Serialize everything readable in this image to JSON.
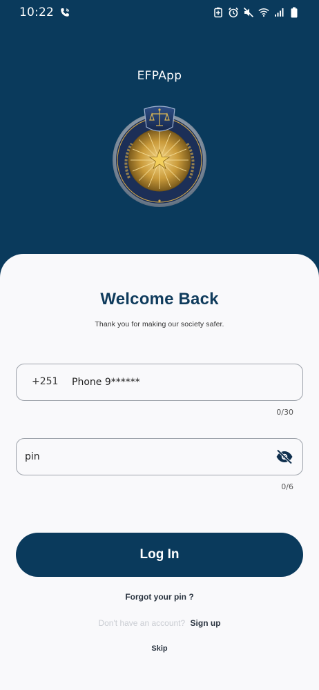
{
  "status_bar": {
    "time": "10:22",
    "icons": [
      "wifi-call-icon",
      "battery-saver-icon",
      "alarm-icon",
      "mute-icon",
      "wifi-icon",
      "signal-icon",
      "battery-icon"
    ]
  },
  "header": {
    "app_title": "EFPApp",
    "logo": "ethiopian-federal-police-emblem"
  },
  "login": {
    "title": "Welcome Back",
    "subtitle": "Thank you for making our society safer.",
    "phone": {
      "prefix": "+251",
      "placeholder": "Phone 9******",
      "value": "",
      "counter": "0/30"
    },
    "pin": {
      "placeholder": "pin",
      "value": "",
      "counter": "0/6"
    },
    "login_label": "Log In",
    "forgot_label": "Forgot your pin ?",
    "no_account_label": "Don't have an account?",
    "signup_label": "Sign up",
    "skip_label": "Skip"
  },
  "colors": {
    "primary": "#0a3a5c",
    "sheet": "#f9f9fb",
    "title": "#0f3b5c"
  }
}
